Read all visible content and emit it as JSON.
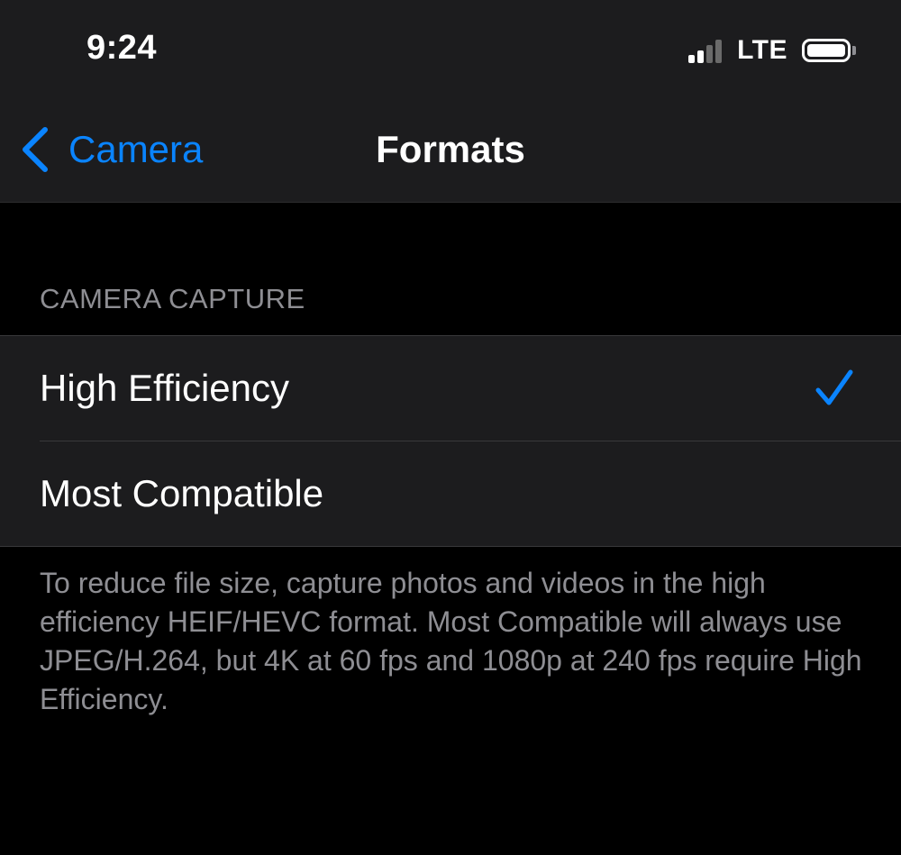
{
  "status_bar": {
    "time": "9:24",
    "network": "LTE",
    "signal_icon": "cellular-signal-icon",
    "battery_icon": "battery-icon"
  },
  "nav": {
    "back_label": "Camera",
    "back_icon": "chevron-left-icon",
    "title": "Formats"
  },
  "section": {
    "header": "CAMERA CAPTURE",
    "options": [
      {
        "label": "High Efficiency",
        "selected": true
      },
      {
        "label": "Most Compatible",
        "selected": false
      }
    ],
    "footer": "To reduce file size, capture photos and videos in the high efficiency HEIF/HEVC format. Most Compatible will always use JPEG/H.264, but 4K at 60 fps and 1080p at 240 fps require High Efficiency."
  },
  "colors": {
    "accent": "#0a84ff",
    "background": "#000000",
    "grouped_background": "#1c1c1e",
    "secondary_label": "#8e8e93"
  }
}
